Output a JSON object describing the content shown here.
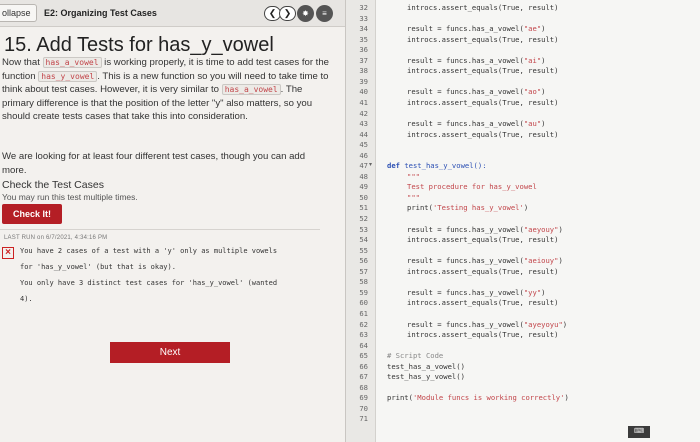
{
  "topbar": {
    "collapse_label": "ollapse",
    "section_title": "E2: Organizing Test Cases",
    "icons": [
      "arrow-left-icon",
      "arrow-right-icon",
      "gear-icon",
      "menu-icon"
    ]
  },
  "lesson": {
    "title": "15. Add Tests for has_y_vowel",
    "p1_a": "Now that ",
    "p1_code1": "has_a_vowel",
    "p1_b": " is working properly, it is time to add test cases for the function ",
    "p1_code2": "has_y_vowel",
    "p1_c": ". This is a new function so you will need to take time to think about test cases. However, it is very similar to ",
    "p1_code3": "has_a_vowel",
    "p1_d": ". The primary difference is that the position of the letter \"y\" also matters, so you should create tests cases that take this into consideration.",
    "p2": "We are looking for at least four different test cases, though you can add more."
  },
  "check": {
    "title": "Check the Test Cases",
    "subtitle": "You may run this test multiple times.",
    "button": "Check It!",
    "last_run": "LAST RUN on 6/7/2021, 4:34:16 PM",
    "feedback": [
      "You have 2 cases of a test with a 'y' only as multiple vowels",
      "for 'has_y_vowel' (but that is okay).",
      "You only have 3 distinct test cases for 'has_y_vowel' (wanted",
      "4)."
    ]
  },
  "next_button": "Next",
  "editor": {
    "line_numbers": [
      "32",
      "33",
      "34",
      "35",
      "36",
      "37",
      "38",
      "39",
      "40",
      "41",
      "42",
      "43",
      "44",
      "45",
      "46",
      "47",
      "48",
      "49",
      "50",
      "51",
      "52",
      "53",
      "54",
      "55",
      "56",
      "57",
      "58",
      "59",
      "60",
      "61",
      "62",
      "63",
      "64",
      "65",
      "66",
      "67",
      "68",
      "69",
      "70",
      "71"
    ],
    "lines": {
      "l32": "introcs.assert_equals(True, result)",
      "l34a": "result = funcs.has_a_vowel(",
      "l34s": "\"ae\"",
      "l35": "introcs.assert_equals(True, result)",
      "l37a": "result = funcs.has_a_vowel(",
      "l37s": "\"ai\"",
      "l38": "introcs.assert_equals(True, result)",
      "l40a": "result = funcs.has_a_vowel(",
      "l40s": "\"ao\"",
      "l41": "introcs.assert_equals(True, result)",
      "l43a": "result = funcs.has_a_vowel(",
      "l43s": "\"au\"",
      "l44": "introcs.assert_equals(True, result)",
      "l47kw": "def ",
      "l47fn": "test_has_y_vowel():",
      "l48": "\"\"\"",
      "l49": "Test procedure for has_y_vowel",
      "l50": "\"\"\"",
      "l51a": "print(",
      "l51s": "'Testing has_y_vowel'",
      "l51b": ")",
      "l53a": "result = funcs.has_y_vowel(",
      "l53s": "\"aeyouy\"",
      "l54": "introcs.assert_equals(True, result)",
      "l56a": "result = funcs.has_y_vowel(",
      "l56s": "\"aeiouy\"",
      "l57": "introcs.assert_equals(True, result)",
      "l59a": "result = funcs.has_y_vowel(",
      "l59s": "\"yy\"",
      "l60": "introcs.assert_equals(True, result)",
      "l62a": "result = funcs.has_y_vowel(",
      "l62s": "\"ayeyoyu\"",
      "l63": "introcs.assert_equals(True, result)",
      "l65": "# Script Code",
      "l66": "test_has_a_vowel()",
      "l67": "test_has_y_vowel()",
      "l69a": "print(",
      "l69s": "'Module funcs is working correctly'",
      "l69b": ")"
    }
  },
  "colors": {
    "accent_red": "#b41e25",
    "string_red": "#c2454a",
    "keyword_blue": "#2b4fb3"
  }
}
